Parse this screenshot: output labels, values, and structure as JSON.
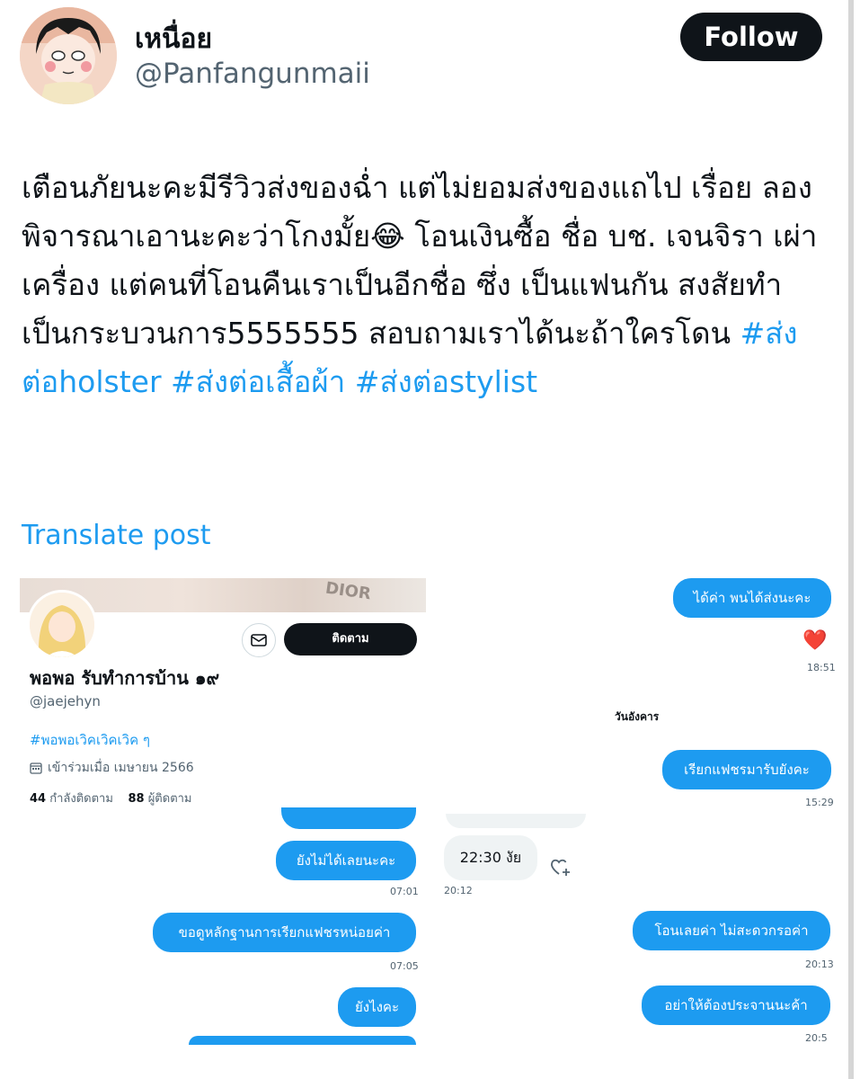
{
  "author": {
    "display_name": "เหนื่อย",
    "handle": "@Panfangunmaii",
    "follow_label": "Follow"
  },
  "post": {
    "text": "เตือนภัยนะคะมีรีวิวส่งของฉ่ำ แต่ไม่ยอมส่งของแถไป เรื่อย ลองพิจารณาเอานะคะว่าโกงมั้ย😂 โอนเงินซื้อ ชื่อ บช. เจนจิรา เผ่าเครื่อง แต่คนที่โอนคืนเราเป็นอีกชื่อ ซึ่ง เป็นแฟนกัน สงสัยทำเป็นกระบวนการ5555555 สอบถามเราได้นะถ้าใครโดน ",
    "hashtags": [
      "#ส่งต่อholster",
      "#ส่งต่อเสื้อผ้า",
      "#ส่งต่อstylist"
    ],
    "translate_label": "Translate post"
  },
  "embedded_profile": {
    "banner_text": "DIOR",
    "name": "พอพอ รับทำการบ้าน ๑๙",
    "handle": "@jaejehyn",
    "bio": "#พอพอเวิคเวิคเวิค ๆ",
    "joined": "เข้าร่วมเมื่อ เมษายน 2566",
    "following_count": "44",
    "following_label": "กำลังติดตาม",
    "followers_count": "88",
    "followers_label": "ผู้ติดตาม",
    "follow_label": "ติดตาม",
    "icons": [
      "mail-icon",
      "calendar-icon"
    ]
  },
  "chat_left": {
    "messages": [
      {
        "text": "ยังไม่ได้เลยนะคะ",
        "time": "07:01"
      },
      {
        "text": "ขอดูหลักฐานการเรียกแฟชรหน่อยค่า",
        "time": "07:05"
      },
      {
        "text": "ยังไงคะ",
        "time": ""
      }
    ],
    "incoming": {
      "text": "22:30 งัย",
      "time": "20:12"
    }
  },
  "chat_right": {
    "messages": [
      {
        "text": "ได้ค่า พนได้ส่งนะคะ",
        "time": "18:51"
      },
      {
        "text": "เรียกแฟชรมารับยังคะ",
        "time": "15:29"
      },
      {
        "text": "โอนเลยค่า ไม่สะดวกรอค่า",
        "time": "20:13"
      },
      {
        "text": "อย่าให้ต้องประจานนะค้า",
        "time": "20:5"
      }
    ],
    "day_label": "วันอังคาร",
    "reaction": "❤️"
  },
  "colors": {
    "accent": "#1d9bf0",
    "text": "#0f1419",
    "muted": "#536471"
  }
}
